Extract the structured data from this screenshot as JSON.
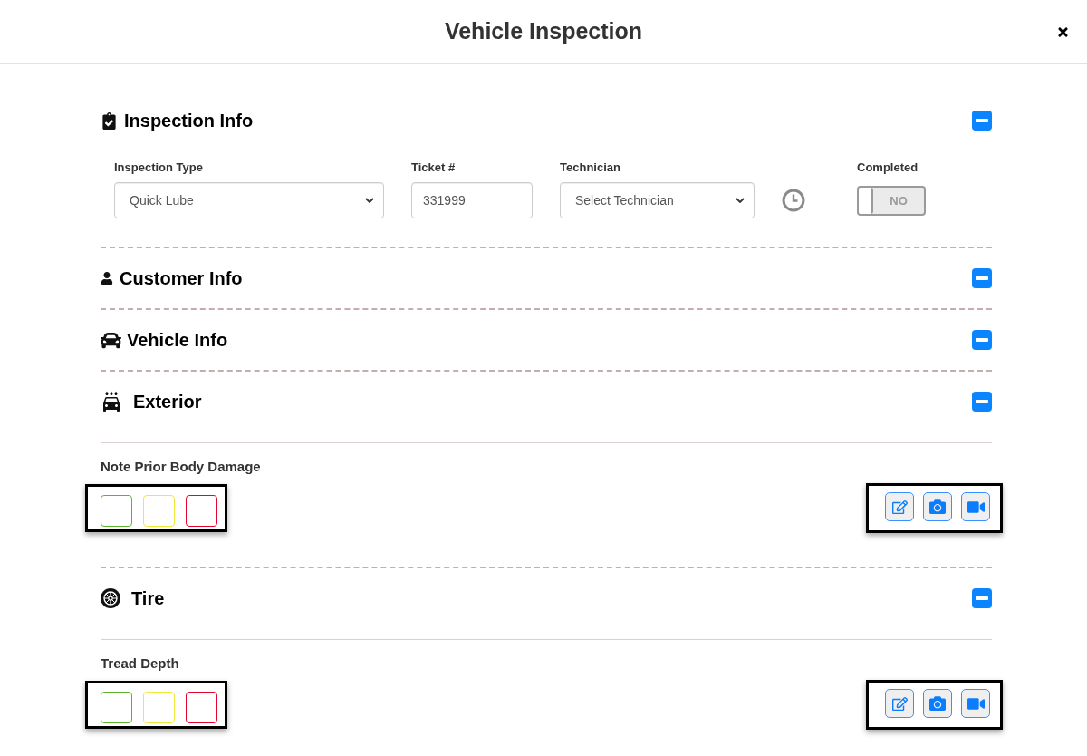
{
  "dialog": {
    "title": "Vehicle Inspection"
  },
  "inspection_info": {
    "title": "Inspection Info",
    "expanded": true,
    "inspection_type": {
      "label": "Inspection Type",
      "value": "Quick Lube"
    },
    "ticket": {
      "label": "Ticket #",
      "value": "331999"
    },
    "technician": {
      "label": "Technician",
      "placeholder": "Select Technician"
    },
    "completed": {
      "label": "Completed",
      "on": false,
      "text": "NO"
    }
  },
  "customer_info": {
    "title": "Customer Info",
    "expanded": true
  },
  "vehicle_info": {
    "title": "Vehicle Info",
    "expanded": true
  },
  "exterior": {
    "title": "Exterior",
    "expanded": true,
    "items": [
      {
        "label": "Note Prior Body Damage",
        "ratings": [
          {
            "color": "#5cb531",
            "selected": false
          },
          {
            "color": "#f2e83c",
            "selected": false
          },
          {
            "color": "#e2062c",
            "selected": false
          }
        ]
      }
    ]
  },
  "tire": {
    "title": "Tire",
    "expanded": true,
    "items": [
      {
        "label": "Tread Depth",
        "ratings": [
          {
            "color": "#5cb531",
            "selected": false
          },
          {
            "color": "#f2e83c",
            "selected": false
          },
          {
            "color": "#e2062c",
            "selected": false
          }
        ]
      }
    ]
  }
}
